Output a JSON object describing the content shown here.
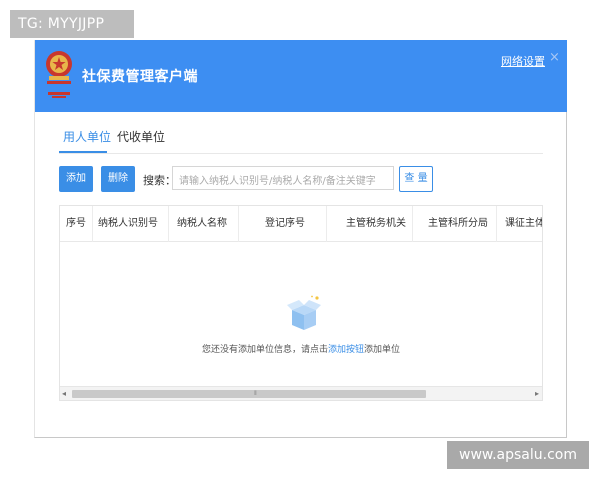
{
  "watermarks": {
    "top_left": "TG: MYYJJPP",
    "bottom_right": "www.apsalu.com"
  },
  "window": {
    "title": "社保费管理客户端",
    "network_settings": "网络设置",
    "close": "×",
    "accent": "#3d8ef2"
  },
  "tabs": [
    {
      "label": "用人单位",
      "active": true
    },
    {
      "label": "代收单位",
      "active": false
    }
  ],
  "toolbar": {
    "add_label": "添加",
    "delete_label": "删除",
    "search_label": "搜索：",
    "search_placeholder": "请输入纳税人识别号/纳税人名称/备注关键字",
    "query_label": "查 量"
  },
  "table": {
    "columns": [
      "序号",
      "纳税人识别号",
      "纳税人名称",
      "登记序号",
      "主管税务机关",
      "主管科所分局",
      "课征主体登"
    ]
  },
  "empty_state": {
    "text_before": "您还没有添加单位信息，请点击",
    "link": "添加按钮",
    "text_after": "添加单位"
  },
  "scrollbar": {
    "left_arrow": "◂",
    "right_arrow": "▸",
    "grip": "⦀"
  },
  "icons": {
    "emblem": "national-emblem-icon",
    "empty": "empty-box-icon"
  }
}
